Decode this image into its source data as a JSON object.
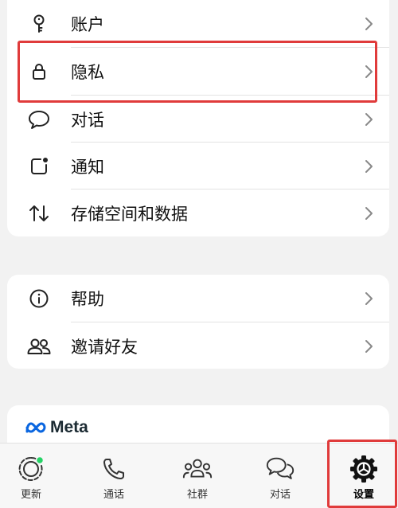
{
  "settings_list": {
    "items": [
      {
        "label": "账户",
        "icon": "key-icon"
      },
      {
        "label": "隐私",
        "icon": "lock-icon"
      },
      {
        "label": "对话",
        "icon": "chat-bubble-icon"
      },
      {
        "label": "通知",
        "icon": "notification-icon"
      },
      {
        "label": "存储空间和数据",
        "icon": "up-down-arrows-icon"
      }
    ]
  },
  "support_list": {
    "items": [
      {
        "label": "帮助",
        "icon": "info-icon"
      },
      {
        "label": "邀请好友",
        "icon": "people-icon"
      }
    ]
  },
  "footer": {
    "brand": "Meta"
  },
  "tab_bar": {
    "tabs": [
      {
        "label": "更新",
        "icon": "status-icon",
        "active": false
      },
      {
        "label": "通话",
        "icon": "phone-icon",
        "active": false
      },
      {
        "label": "社群",
        "icon": "community-icon",
        "active": false
      },
      {
        "label": "对话",
        "icon": "chats-icon",
        "active": false
      },
      {
        "label": "设置",
        "icon": "settings-gear-icon",
        "active": true
      }
    ]
  },
  "colors": {
    "highlight": "#e03b3b",
    "background": "#f2f2f2",
    "card": "#ffffff",
    "status_dot": "#25d366"
  }
}
